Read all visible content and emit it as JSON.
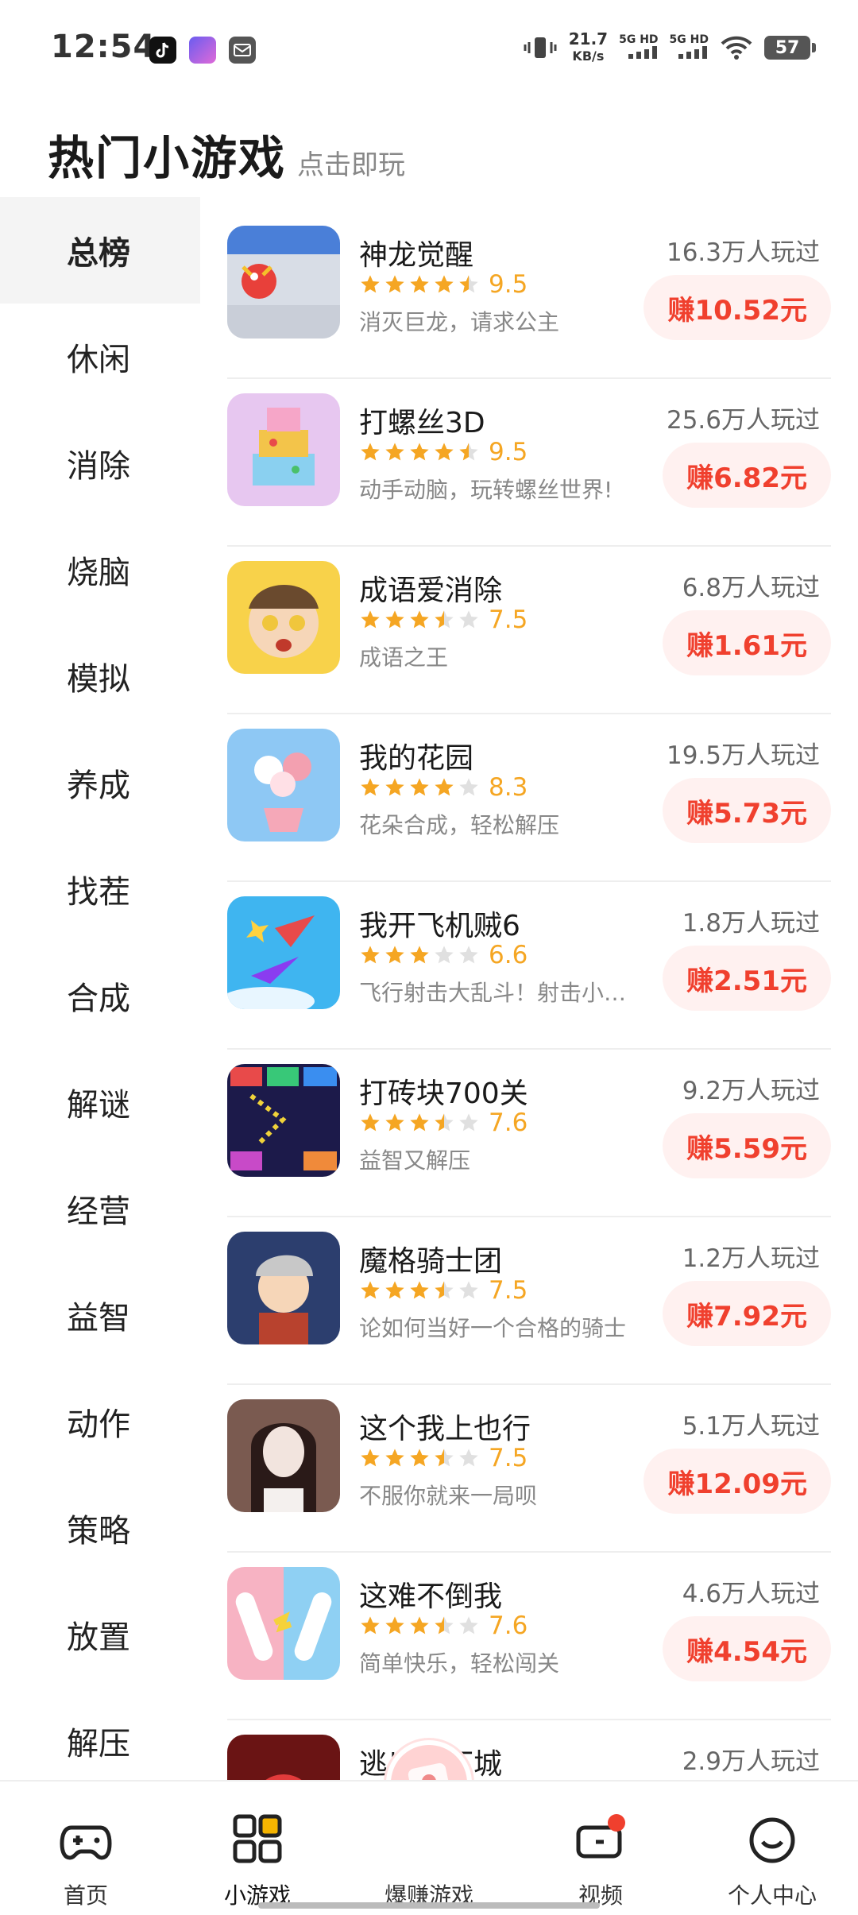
{
  "status_bar": {
    "time": "12:54",
    "speed_value": "21.7",
    "speed_unit": "KB/s",
    "signal1": "5G HD",
    "signal2": "5G HD",
    "battery": "57"
  },
  "header": {
    "title": "热门小游戏",
    "subtitle": "点击即玩"
  },
  "categories": [
    {
      "label": "总榜",
      "active": true
    },
    {
      "label": "休闲"
    },
    {
      "label": "消除"
    },
    {
      "label": "烧脑"
    },
    {
      "label": "模拟"
    },
    {
      "label": "养成"
    },
    {
      "label": "找茬"
    },
    {
      "label": "合成"
    },
    {
      "label": "解谜"
    },
    {
      "label": "经营"
    },
    {
      "label": "益智"
    },
    {
      "label": "动作"
    },
    {
      "label": "策略"
    },
    {
      "label": "放置"
    },
    {
      "label": "解压"
    }
  ],
  "games": [
    {
      "name": "神龙觉醒",
      "rating": 4.5,
      "score": "9.5",
      "desc": "消灭巨龙，请求公主",
      "plays": "16.3万人玩过",
      "earn": "赚10.52元",
      "icon": "dragon-game-icon",
      "colors": [
        "#4a7fd8",
        "#d8dde6"
      ]
    },
    {
      "name": "打螺丝3D",
      "rating": 4.5,
      "score": "9.5",
      "desc": "动手动脑，玩转螺丝世界!",
      "plays": "25.6万人玩过",
      "earn": "赚6.82元",
      "icon": "screw-game-icon",
      "colors": [
        "#e7c7f0",
        "#f6a6c8"
      ]
    },
    {
      "name": "成语爱消除",
      "rating": 3.5,
      "score": "7.5",
      "desc": "成语之王",
      "plays": "6.8万人玩过",
      "earn": "赚1.61元",
      "icon": "idiom-game-icon",
      "colors": [
        "#f8d24a",
        "#6a4a2e"
      ]
    },
    {
      "name": "我的花园",
      "rating": 4,
      "score": "8.3",
      "desc": "花朵合成，轻松解压",
      "plays": "19.5万人玩过",
      "earn": "赚5.73元",
      "icon": "garden-game-icon",
      "colors": [
        "#8ec8f4",
        "#f5a8b8"
      ]
    },
    {
      "name": "我开飞机贼6",
      "rating": 3,
      "score": "6.6",
      "desc": "飞行射击大乱斗！射击小游戏",
      "plays": "1.8万人玩过",
      "earn": "赚2.51元",
      "icon": "plane-game-icon",
      "colors": [
        "#3fb5f0",
        "#e8f6ff"
      ]
    },
    {
      "name": "打砖块700关",
      "rating": 3.5,
      "score": "7.6",
      "desc": "益智又解压",
      "plays": "9.2万人玩过",
      "earn": "赚5.59元",
      "icon": "bricks-game-icon",
      "colors": [
        "#1c1a4a",
        "#f0d23a"
      ]
    },
    {
      "name": "魔格骑士团",
      "rating": 3.5,
      "score": "7.5",
      "desc": "论如何当好一个合格的骑士",
      "plays": "1.2万人玩过",
      "earn": "赚7.92元",
      "icon": "knight-game-icon",
      "colors": [
        "#2c3e6e",
        "#c8c8c8"
      ]
    },
    {
      "name": "这个我上也行",
      "rating": 3.5,
      "score": "7.5",
      "desc": "不服你就来一局呗",
      "plays": "5.1万人玩过",
      "earn": "赚12.09元",
      "icon": "girl-game-icon",
      "colors": [
        "#7a5a50",
        "#f2e4de"
      ]
    },
    {
      "name": "这难不倒我",
      "rating": 3.5,
      "score": "7.6",
      "desc": "简单快乐，轻松闯关",
      "plays": "4.6万人玩过",
      "earn": "赚4.54元",
      "icon": "tubes-game-icon",
      "colors": [
        "#f7b3c3",
        "#8fd0f3"
      ]
    },
    {
      "name": "逃出地下城",
      "rating": 0,
      "score": "",
      "desc": "",
      "plays": "2.9万人玩过",
      "earn": "",
      "icon": "dungeon-game-icon",
      "colors": [
        "#6a1414",
        "#e23b3b"
      ]
    }
  ],
  "tabbar": {
    "items": [
      {
        "label": "首页",
        "icon": "gamepad-icon"
      },
      {
        "label": "小游戏",
        "icon": "grid-icon",
        "active": true
      },
      {
        "label": "爆赚游戏",
        "icon": "money-icon"
      },
      {
        "label": "视频",
        "icon": "video-icon"
      },
      {
        "label": "个人中心",
        "icon": "smiley-icon"
      }
    ]
  }
}
